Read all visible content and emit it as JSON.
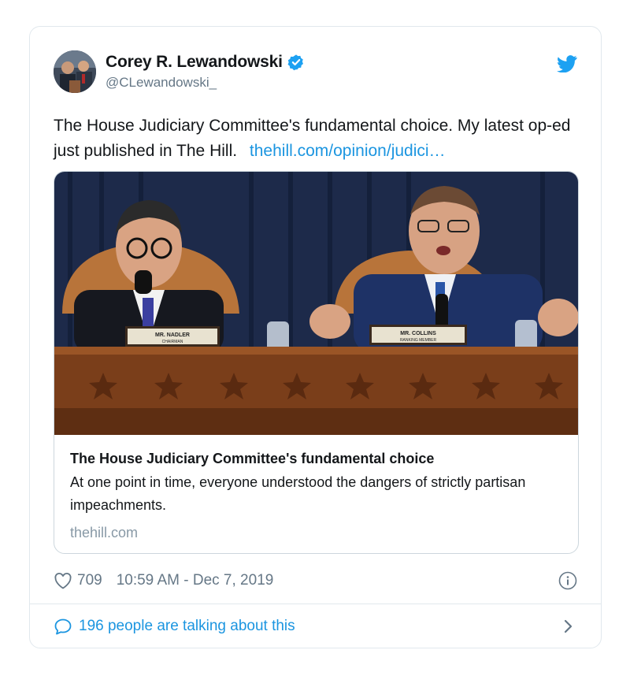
{
  "author": {
    "display_name": "Corey R. Lewandowski",
    "handle": "@CLewandowski_"
  },
  "tweet": {
    "text": "The House Judiciary Committee's fundamental choice. My latest op-ed just published in The Hill.",
    "link_text": "thehill.com/opinion/judici…"
  },
  "card": {
    "image_placards": [
      "MR. NADLER",
      "CHAIRMAN",
      "MR. COLLINS",
      "RANKING MEMBER"
    ],
    "title": "The House Judiciary Committee's fundamental choice",
    "description": "At one point in time, everyone understood the dangers of strictly partisan impeachments.",
    "domain": "thehill.com"
  },
  "meta": {
    "like_count": "709",
    "timestamp": "10:59 AM - Dec 7, 2019"
  },
  "conversation": {
    "label": "196 people are talking about this"
  },
  "icons": {
    "verified": "verified-badge-icon",
    "bird": "twitter-bird-icon",
    "like": "heart-icon",
    "info": "info-icon",
    "reply": "comment-icon",
    "chevron": "chevron-right-icon"
  },
  "colors": {
    "brand_blue": "#1da1f2",
    "link_blue": "#1b95e0",
    "secondary_text": "#657786",
    "border": "#e1e8ed"
  }
}
